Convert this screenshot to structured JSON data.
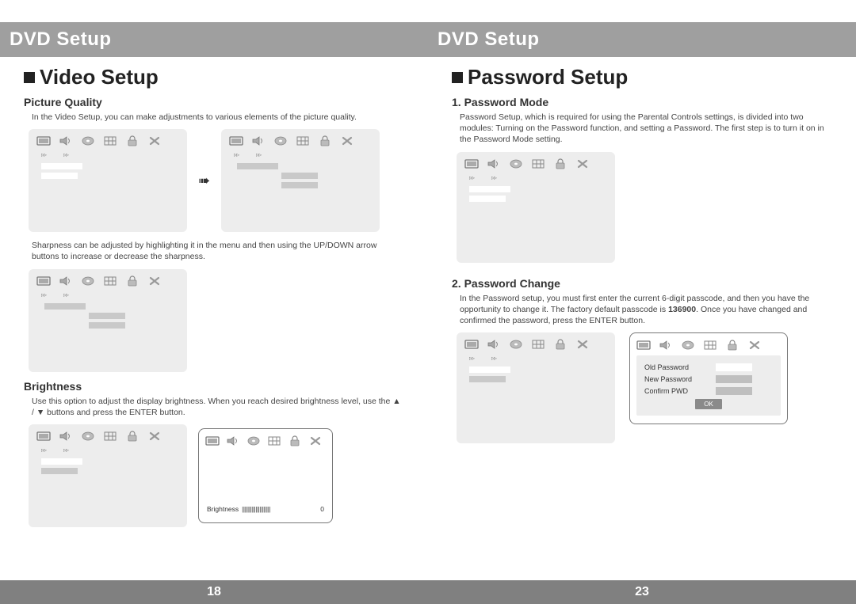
{
  "left": {
    "header": "DVD Setup",
    "section_title": "Video Setup",
    "picture_quality": {
      "title": "Picture Quality",
      "intro": "In the Video Setup, you can make adjustments to various elements of the picture quality.",
      "sharpness_note": "Sharpness can be adjusted by highlighting it in the menu and then using the UP/DOWN arrow buttons to increase or decrease the sharpness."
    },
    "brightness": {
      "title": "Brightness",
      "text": "Use this option to adjust the display brightness. When you reach desired brightness level, use the ▲ / ▼ buttons and press the ENTER button.",
      "slider_label": "Brightness",
      "slider_value": "0"
    },
    "page_number": "18"
  },
  "right": {
    "header": "DVD Setup",
    "section_title": "Password Setup",
    "password_mode": {
      "title": "1. Password Mode",
      "text": "Password Setup, which is required for using the Parental Controls settings, is divided into two modules: Turning on the Password function, and setting a Password. The first step is to turn it on in the Password Mode setting."
    },
    "password_change": {
      "title": "2. Password Change",
      "text_pre": "In the Password setup, you must first enter the current 6-digit passcode, and then you have the opportunity to change it. The factory default passcode is ",
      "default_code": "136900",
      "text_post": ". Once you have changed and confirmed the password, press the ENTER button.",
      "fields": {
        "old": "Old Password",
        "new": "New Password",
        "confirm": "Confirm PWD",
        "ok": "OK"
      }
    },
    "page_number": "23"
  },
  "icons": [
    "display-icon",
    "speaker-icon",
    "disc-icon",
    "grid-icon",
    "lock-icon",
    "close-icon"
  ]
}
